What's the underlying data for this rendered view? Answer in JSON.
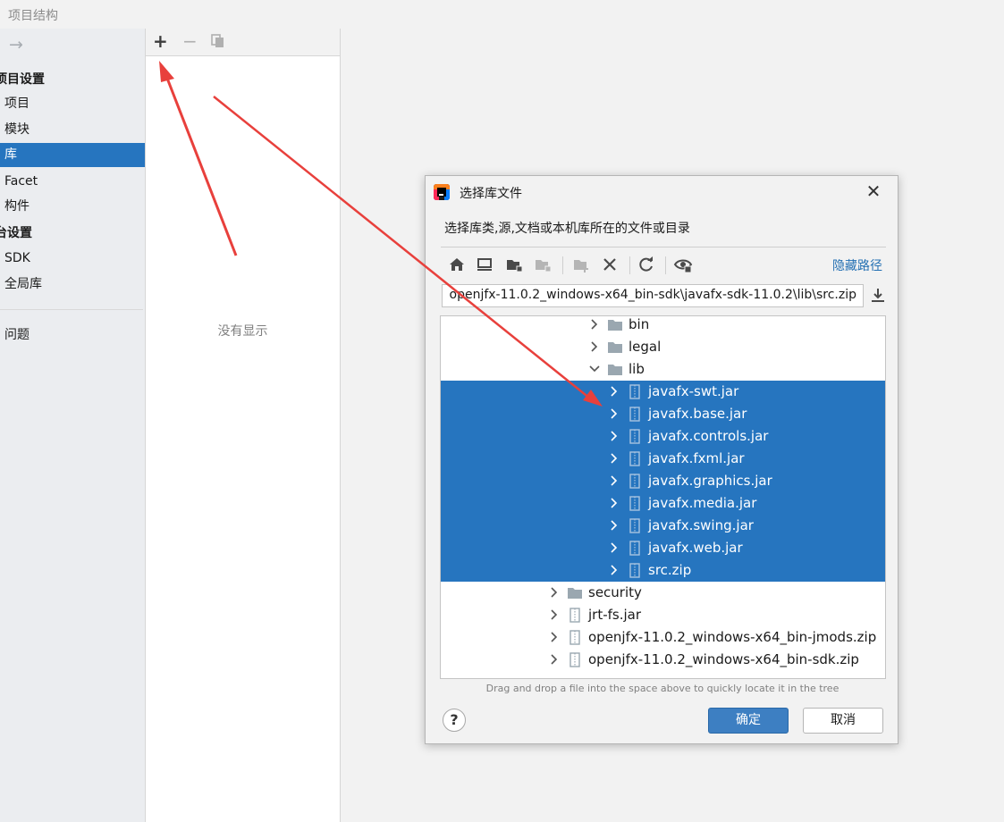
{
  "window": {
    "title": "项目结构"
  },
  "sidebar": {
    "nav_forward_icon": "arrow-right-icon",
    "items": [
      {
        "label": "项目设置",
        "kind": "header"
      },
      {
        "label": "项目",
        "kind": "item"
      },
      {
        "label": "模块",
        "kind": "item"
      },
      {
        "label": "库",
        "kind": "item",
        "selected": true
      },
      {
        "label": "Facet",
        "kind": "item"
      },
      {
        "label": "构件",
        "kind": "item"
      },
      {
        "label": "台设置",
        "kind": "header"
      },
      {
        "label": "SDK",
        "kind": "item"
      },
      {
        "label": "全局库",
        "kind": "item"
      },
      {
        "label": "问题",
        "kind": "item"
      }
    ]
  },
  "library_panel": {
    "add_icon": "+",
    "remove_icon": "−",
    "copy_icon": "copy-icon",
    "empty_text": "没有显示"
  },
  "dialog": {
    "title": "选择库文件",
    "description": "选择库类,源,文档或本机库所在的文件或目录",
    "hide_path": "隐藏路径",
    "path_value": "openjfx-11.0.2_windows-x64_bin-sdk\\javafx-sdk-11.0.2\\lib\\src.zip",
    "toolbar_icons": [
      "home-icon",
      "desktop-icon",
      "project-folder-icon",
      "module-folder-icon",
      "new-folder-icon",
      "delete-icon",
      "refresh-icon",
      "show-hidden-icon"
    ],
    "tree": [
      {
        "label": "bin",
        "type": "folder",
        "expanded": false,
        "selected": false
      },
      {
        "label": "legal",
        "type": "folder",
        "expanded": false,
        "selected": false
      },
      {
        "label": "lib",
        "type": "folder",
        "expanded": true,
        "selected": false
      },
      {
        "label": "javafx-swt.jar",
        "type": "archive",
        "expanded": false,
        "selected": true
      },
      {
        "label": "javafx.base.jar",
        "type": "archive",
        "expanded": false,
        "selected": true
      },
      {
        "label": "javafx.controls.jar",
        "type": "archive",
        "expanded": false,
        "selected": true
      },
      {
        "label": "javafx.fxml.jar",
        "type": "archive",
        "expanded": false,
        "selected": true
      },
      {
        "label": "javafx.graphics.jar",
        "type": "archive",
        "expanded": false,
        "selected": true
      },
      {
        "label": "javafx.media.jar",
        "type": "archive",
        "expanded": false,
        "selected": true
      },
      {
        "label": "javafx.swing.jar",
        "type": "archive",
        "expanded": false,
        "selected": true
      },
      {
        "label": "javafx.web.jar",
        "type": "archive",
        "expanded": false,
        "selected": true
      },
      {
        "label": "src.zip",
        "type": "archive",
        "expanded": false,
        "selected": true
      },
      {
        "label": "security",
        "type": "folder",
        "expanded": false,
        "selected": false
      },
      {
        "label": "jrt-fs.jar",
        "type": "archive",
        "expanded": false,
        "selected": false
      },
      {
        "label": "openjfx-11.0.2_windows-x64_bin-jmods.zip",
        "type": "archive",
        "expanded": false,
        "selected": false
      },
      {
        "label": "openjfx-11.0.2_windows-x64_bin-sdk.zip",
        "type": "archive",
        "expanded": false,
        "selected": false
      }
    ],
    "drag_hint": "Drag and drop a file into the space above to quickly locate it in the tree",
    "help_label": "?",
    "ok_label": "确定",
    "cancel_label": "取消"
  },
  "colors": {
    "selection": "#2675bf",
    "link": "#2470b3",
    "annotation_arrow": "#e8403c",
    "primary_button": "#3d7fc2"
  }
}
